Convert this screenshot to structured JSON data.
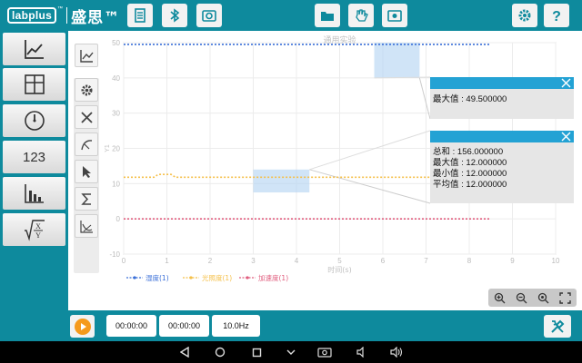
{
  "app": {
    "logo_text": "labplus",
    "logo_tm": "™",
    "brand_cn": "盛思™"
  },
  "toolbar": {
    "buttons": [
      "notes-icon",
      "bluetooth-icon",
      "camera-icon",
      "folder-icon",
      "hand-icon",
      "photo-icon",
      "gear-icon",
      "help-icon"
    ]
  },
  "sidebar": {
    "items": [
      {
        "icon": "line-chart-icon"
      },
      {
        "icon": "table-icon"
      },
      {
        "icon": "gauge-icon"
      },
      {
        "icon": "numeric-icon",
        "label": "123"
      },
      {
        "icon": "bar-chart-icon"
      },
      {
        "icon": "formula-icon"
      }
    ]
  },
  "chart_tools": [
    "chart-type-icon",
    "settings-icon",
    "clear-icon",
    "curve-fit-icon",
    "pointer-icon",
    "sum-icon",
    "tangent-icon"
  ],
  "chart_data": {
    "type": "line",
    "title": "通用实验",
    "xlabel": "时间(s)",
    "ylabel": "Y1",
    "xlim": [
      0,
      10
    ],
    "ylim": [
      -10,
      50
    ],
    "x_ticks": [
      "0",
      "1",
      "2",
      "3",
      "4",
      "5",
      "6",
      "7",
      "8",
      "9",
      "10"
    ],
    "y_ticks": [
      "-10",
      "0",
      "10",
      "20",
      "30",
      "40",
      "50"
    ],
    "grid": true,
    "legend_position": "bottom-left",
    "series": [
      {
        "name": "湿度(1)",
        "color": "#3a6fd8",
        "x": [
          0,
          8.5
        ],
        "y": [
          49.5,
          49.5
        ]
      },
      {
        "name": "光照度(1)",
        "color": "#f5c04a",
        "x": [
          0,
          0.7,
          0.8,
          1.1,
          1.2,
          8.5
        ],
        "y": [
          11.8,
          11.8,
          12.6,
          12.6,
          11.8,
          11.8
        ]
      },
      {
        "name": "加速度(1)",
        "color": "#e05d7e",
        "x": [
          0,
          8.5
        ],
        "y": [
          0,
          0
        ]
      }
    ],
    "selections": [
      {
        "x": [
          5.8,
          6.85
        ],
        "y": [
          40,
          50
        ]
      },
      {
        "x": [
          3.0,
          4.3
        ],
        "y": [
          7.5,
          14
        ]
      }
    ]
  },
  "popup_max": {
    "label": "最大值 : 49.500000"
  },
  "popup_stats": {
    "sum": "总和 : 156.000000",
    "max": "最大值 : 12.000000",
    "min": "最小值 : 12.000000",
    "avg": "平均值 : 12.000000"
  },
  "bottom": {
    "start_time": "00:00:00",
    "end_time": "00:00:00",
    "rate": "10.0Hz"
  }
}
